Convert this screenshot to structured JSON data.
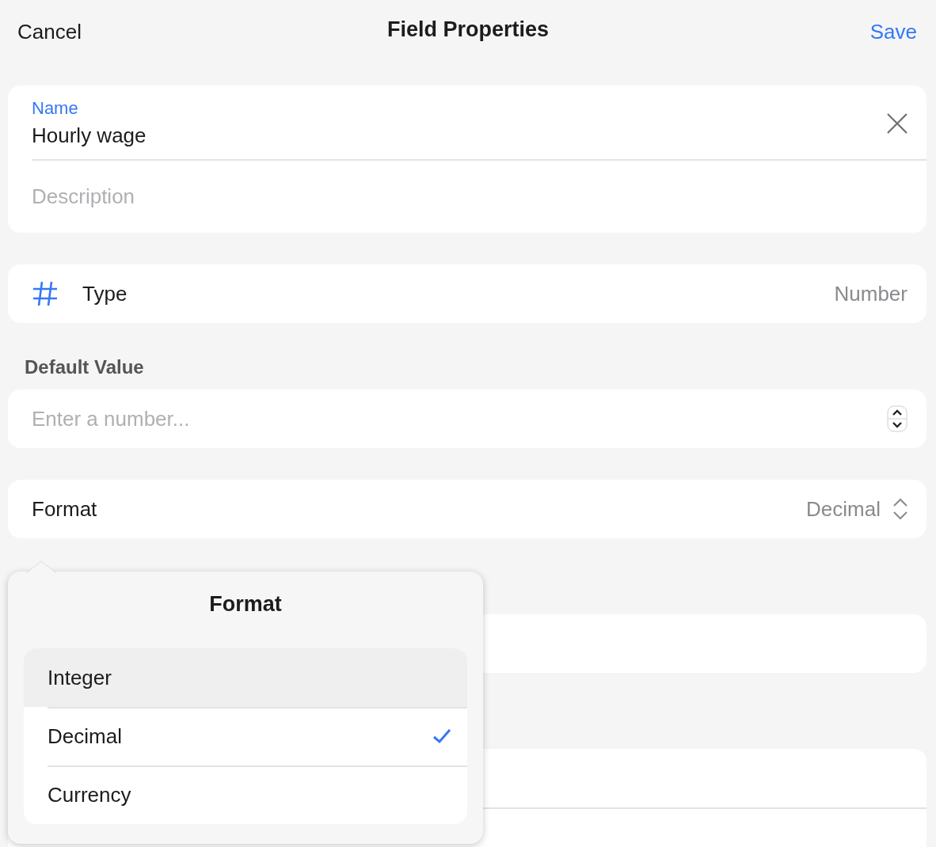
{
  "header": {
    "cancel": "Cancel",
    "title": "Field Properties",
    "save": "Save"
  },
  "name_field": {
    "label": "Name",
    "value": "Hourly wage"
  },
  "description_field": {
    "placeholder": "Description"
  },
  "type_row": {
    "label": "Type",
    "value": "Number"
  },
  "default_value": {
    "heading": "Default Value",
    "placeholder": "Enter a number..."
  },
  "format_row": {
    "label": "Format",
    "value": "Decimal"
  },
  "format_popover": {
    "title": "Format",
    "options": [
      {
        "label": "Integer",
        "selected": false,
        "highlighted": true
      },
      {
        "label": "Decimal",
        "selected": true,
        "highlighted": false
      },
      {
        "label": "Currency",
        "selected": false,
        "highlighted": false
      }
    ]
  }
}
